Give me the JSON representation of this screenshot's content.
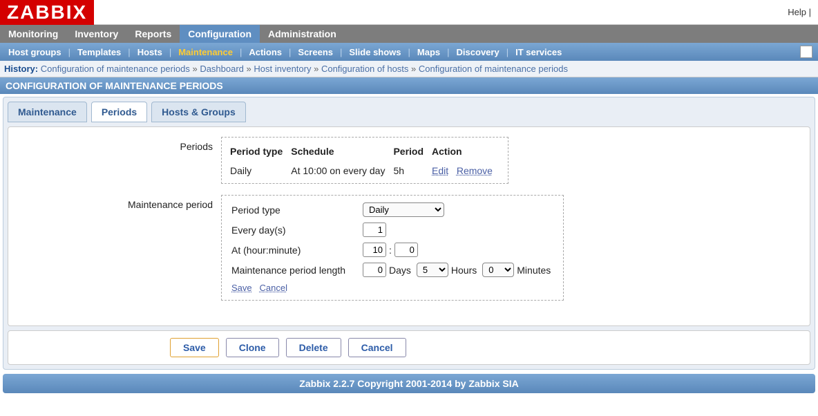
{
  "top": {
    "logo": "ZABBIX",
    "help": "Help |"
  },
  "main_nav": [
    {
      "label": "Monitoring",
      "active": false
    },
    {
      "label": "Inventory",
      "active": false
    },
    {
      "label": "Reports",
      "active": false
    },
    {
      "label": "Configuration",
      "active": true
    },
    {
      "label": "Administration",
      "active": false
    }
  ],
  "sub_nav": [
    {
      "label": "Host groups"
    },
    {
      "label": "Templates"
    },
    {
      "label": "Hosts"
    },
    {
      "label": "Maintenance",
      "current": true
    },
    {
      "label": "Actions"
    },
    {
      "label": "Screens"
    },
    {
      "label": "Slide shows"
    },
    {
      "label": "Maps"
    },
    {
      "label": "Discovery"
    },
    {
      "label": "IT services"
    }
  ],
  "history": {
    "label": "History:",
    "items": [
      "Configuration of maintenance periods",
      "Dashboard",
      "Host inventory",
      "Configuration of hosts",
      "Configuration of maintenance periods"
    ]
  },
  "page_title": "CONFIGURATION OF MAINTENANCE PERIODS",
  "tabs": [
    {
      "label": "Maintenance",
      "active": false
    },
    {
      "label": "Periods",
      "active": true
    },
    {
      "label": "Hosts & Groups",
      "active": false
    }
  ],
  "periods_section": {
    "label": "Periods",
    "headers": {
      "type": "Period type",
      "schedule": "Schedule",
      "period": "Period",
      "action": "Action"
    },
    "row": {
      "type": "Daily",
      "schedule": "At 10:00 on every day",
      "period": "5h",
      "edit": "Edit",
      "remove": "Remove"
    }
  },
  "maint_section": {
    "label": "Maintenance period",
    "period_type_label": "Period type",
    "period_type_value": "Daily",
    "every_days_label": "Every day(s)",
    "every_days_value": "1",
    "at_label": "At (hour:minute)",
    "at_hour": "10",
    "at_min": "0",
    "length_label": "Maintenance period length",
    "length_days": "0",
    "days_text": "Days",
    "length_hours": "5",
    "hours_text": "Hours",
    "length_mins": "0",
    "mins_text": "Minutes",
    "save": "Save",
    "cancel": "Cancel"
  },
  "buttons": {
    "save": "Save",
    "clone": "Clone",
    "delete": "Delete",
    "cancel": "Cancel"
  },
  "footer": "Zabbix 2.2.7 Copyright 2001-2014 by Zabbix SIA"
}
